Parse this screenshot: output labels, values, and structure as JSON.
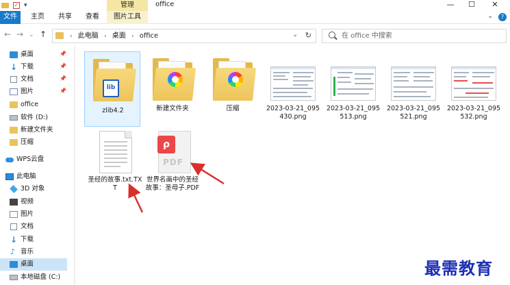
{
  "titlebar": {
    "context_tab": "管理",
    "title": "office",
    "minimize": "—",
    "maximize": "☐",
    "close": "✕"
  },
  "ribbon": {
    "tabs": [
      "文件",
      "主页",
      "共享",
      "查看",
      "图片工具"
    ],
    "expand": "⌄",
    "help": "?"
  },
  "nav": {
    "back": "←",
    "forward": "→",
    "recent": "⌄",
    "up": "↑",
    "crumbs": [
      "此电脑",
      "桌面",
      "office"
    ],
    "dropdown": "⌄",
    "refresh": "↻",
    "search_placeholder": "在 office 中搜索"
  },
  "sidebar": {
    "items": [
      {
        "label": "桌面",
        "icon": "desktop-icon",
        "pinned": true
      },
      {
        "label": "下载",
        "icon": "download-icon",
        "pinned": true
      },
      {
        "label": "文档",
        "icon": "document-icon",
        "pinned": true
      },
      {
        "label": "图片",
        "icon": "picture-icon",
        "pinned": true
      },
      {
        "label": "office",
        "icon": "folder-icon",
        "pinned": false
      },
      {
        "label": "软件 (D:)",
        "icon": "drive-icon",
        "pinned": false
      },
      {
        "label": "新建文件夹",
        "icon": "folder-icon",
        "pinned": false
      },
      {
        "label": "压缩",
        "icon": "folder-icon",
        "pinned": false
      },
      {
        "label": "WPS云盘",
        "icon": "cloud-icon",
        "pinned": false
      },
      {
        "label": "此电脑",
        "icon": "computer-icon",
        "pinned": false
      },
      {
        "label": "3D 对象",
        "icon": "3d-objects-icon",
        "pinned": false
      },
      {
        "label": "视频",
        "icon": "video-icon",
        "pinned": false
      },
      {
        "label": "图片",
        "icon": "picture-icon",
        "pinned": false
      },
      {
        "label": "文档",
        "icon": "document-icon",
        "pinned": false
      },
      {
        "label": "下载",
        "icon": "download-icon",
        "pinned": false
      },
      {
        "label": "音乐",
        "icon": "music-icon",
        "pinned": false
      },
      {
        "label": "桌面",
        "icon": "desktop-icon",
        "pinned": false
      },
      {
        "label": "本地磁盘 (C:)",
        "icon": "drive-icon",
        "pinned": false
      }
    ],
    "pin_glyph": "📌"
  },
  "files": [
    {
      "name": "zlib4.2",
      "type": "folder"
    },
    {
      "name": "新建文件夹",
      "type": "folder"
    },
    {
      "name": "压缩",
      "type": "folder"
    },
    {
      "name": "2023-03-21_095430.png",
      "type": "image"
    },
    {
      "name": "2023-03-21_095513.png",
      "type": "image"
    },
    {
      "name": "2023-03-21_095521.png",
      "type": "image"
    },
    {
      "name": "2023-03-21_095532.png",
      "type": "image"
    },
    {
      "name": "圣经的故事.txt.TXT",
      "type": "txt"
    },
    {
      "name": "世界名画中的圣经故事：圣母子.PDF",
      "type": "pdf"
    }
  ],
  "icons": {
    "lib_mark": "lib",
    "pdf_label": "PDF",
    "pdf_glyph": "ρ",
    "qa_check": "✓",
    "qa_arrow": "▾"
  },
  "colors": {
    "file_tab": "#1979ca",
    "selected": "#cce4f7",
    "arrow": "#d9302c",
    "watermark": "#1c2fb2"
  },
  "watermark": "最需教育"
}
